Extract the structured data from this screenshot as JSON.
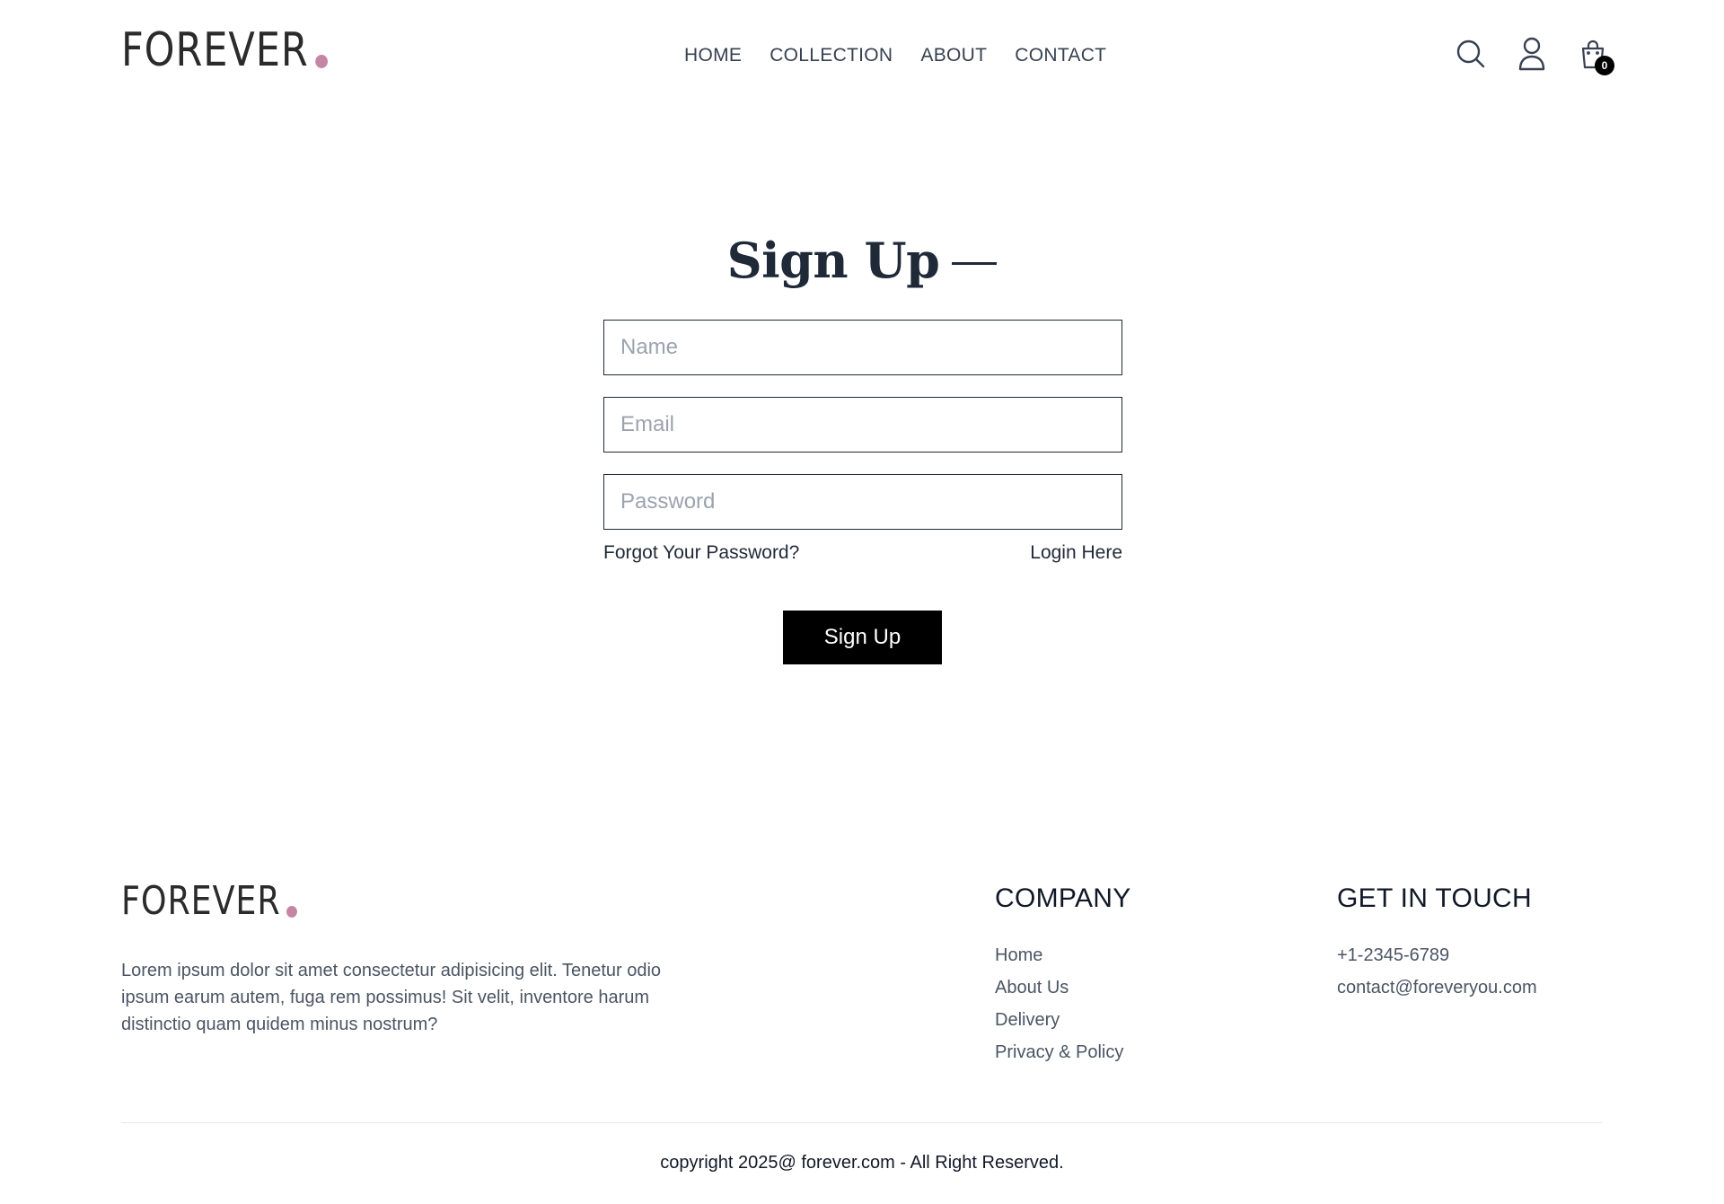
{
  "brand": {
    "name": "FOREVER",
    "accent_dot_color": "#c586a5"
  },
  "nav": {
    "items": [
      {
        "label": "HOME"
      },
      {
        "label": "COLLECTION"
      },
      {
        "label": "ABOUT"
      },
      {
        "label": "CONTACT"
      }
    ]
  },
  "header_icons": {
    "search": "search-icon",
    "profile": "user-icon",
    "cart": "shopping-bag-icon",
    "cart_count": "0"
  },
  "form": {
    "title": "Sign Up",
    "name_placeholder": "Name",
    "email_placeholder": "Email",
    "password_placeholder": "Password",
    "forgot_link": "Forgot Your Password?",
    "login_link": "Login Here",
    "submit_label": "Sign Up"
  },
  "footer": {
    "about_text": "Lorem ipsum dolor sit amet consectetur adipisicing elit. Tenetur odio ipsum earum autem, fuga rem possimus! Sit velit, inventore harum distinctio quam quidem minus nostrum?",
    "company": {
      "heading": "COMPANY",
      "links": [
        "Home",
        "About Us",
        "Delivery",
        "Privacy & Policy"
      ]
    },
    "contact": {
      "heading": "GET IN TOUCH",
      "phone": "+1-2345-6789",
      "email": "contact@foreveryou.com"
    },
    "copyright": "copyright 2025@ forever.com - All Right Reserved."
  }
}
